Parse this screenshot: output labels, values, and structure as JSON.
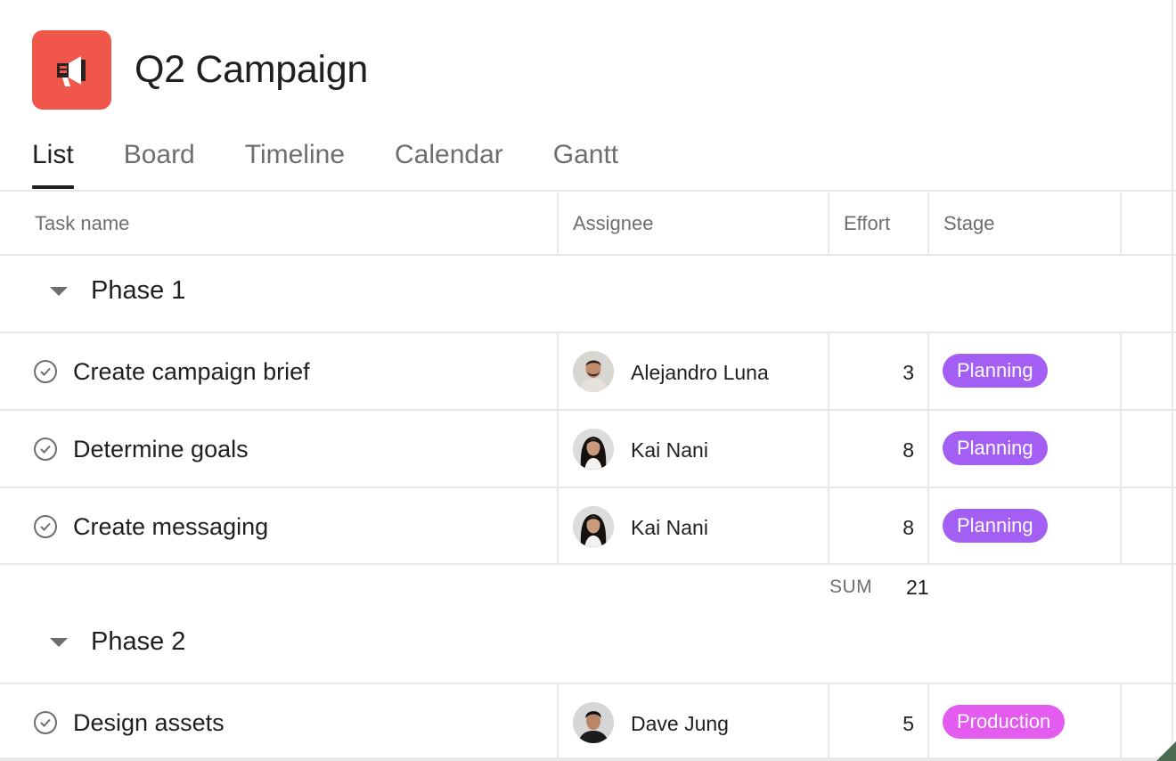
{
  "project": {
    "title": "Q2 Campaign",
    "icon": "megaphone-icon",
    "icon_color": "#f0564a"
  },
  "tabs": [
    {
      "label": "List",
      "active": true
    },
    {
      "label": "Board",
      "active": false
    },
    {
      "label": "Timeline",
      "active": false
    },
    {
      "label": "Calendar",
      "active": false
    },
    {
      "label": "Gantt",
      "active": false
    }
  ],
  "columns": {
    "task_name": "Task name",
    "assignee": "Assignee",
    "effort": "Effort",
    "stage": "Stage"
  },
  "sections": [
    {
      "title": "Phase 1",
      "tasks": [
        {
          "name": "Create campaign brief",
          "assignee": "Alejandro Luna",
          "effort": "3",
          "stage": "Planning"
        },
        {
          "name": "Determine goals",
          "assignee": "Kai Nani",
          "effort": "8",
          "stage": "Planning"
        },
        {
          "name": "Create messaging",
          "assignee": "Kai Nani",
          "effort": "8",
          "stage": "Planning"
        }
      ],
      "sum_label": "SUM",
      "sum_value": "21"
    },
    {
      "title": "Phase 2",
      "tasks": [
        {
          "name": "Design assets",
          "assignee": "Dave Jung",
          "effort": "5",
          "stage": "Production"
        }
      ]
    }
  ],
  "stage_colors": {
    "Planning": "#a35ff3",
    "Production": "#e45bf0"
  }
}
